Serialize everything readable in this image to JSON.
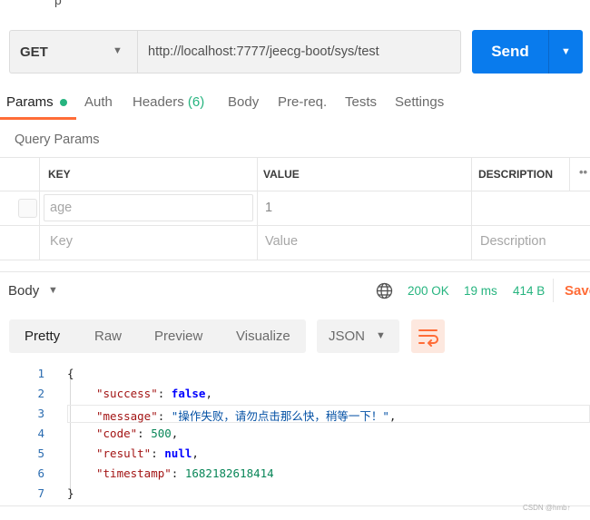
{
  "request": {
    "method": "GET",
    "url": "http://localhost:7777/jeecg-boot/sys/test",
    "send_label": "Send"
  },
  "tabs": {
    "params": "Params",
    "auth": "Auth",
    "headers": "Headers",
    "headers_count": "(6)",
    "body": "Body",
    "prereq": "Pre-req.",
    "tests": "Tests",
    "settings": "Settings"
  },
  "query_params": {
    "title": "Query Params",
    "columns": {
      "key": "KEY",
      "value": "VALUE",
      "description": "DESCRIPTION"
    },
    "row": {
      "key": "age",
      "value": "1"
    },
    "placeholders": {
      "key": "Key",
      "value": "Value",
      "description": "Description"
    }
  },
  "response": {
    "body_label": "Body",
    "status": "200 OK",
    "time": "19 ms",
    "size": "414 B",
    "save_label": "Save",
    "views": [
      "Pretty",
      "Raw",
      "Preview",
      "Visualize"
    ],
    "format": "JSON",
    "line_numbers": [
      "1",
      "2",
      "3",
      "4",
      "5",
      "6",
      "7"
    ],
    "json": {
      "open_brace": "{",
      "close_brace": "}",
      "success_key": "\"success\"",
      "success_val": "false",
      "message_key": "\"message\"",
      "message_val": "\"操作失败，请勿点击那么快，稍等一下！\"",
      "code_key": "\"code\"",
      "code_val": "500",
      "result_key": "\"result\"",
      "result_val": "null",
      "timestamp_key": "\"timestamp\"",
      "timestamp_val": "1682182618414"
    }
  },
  "watermark": "CSDN @hmb↑"
}
